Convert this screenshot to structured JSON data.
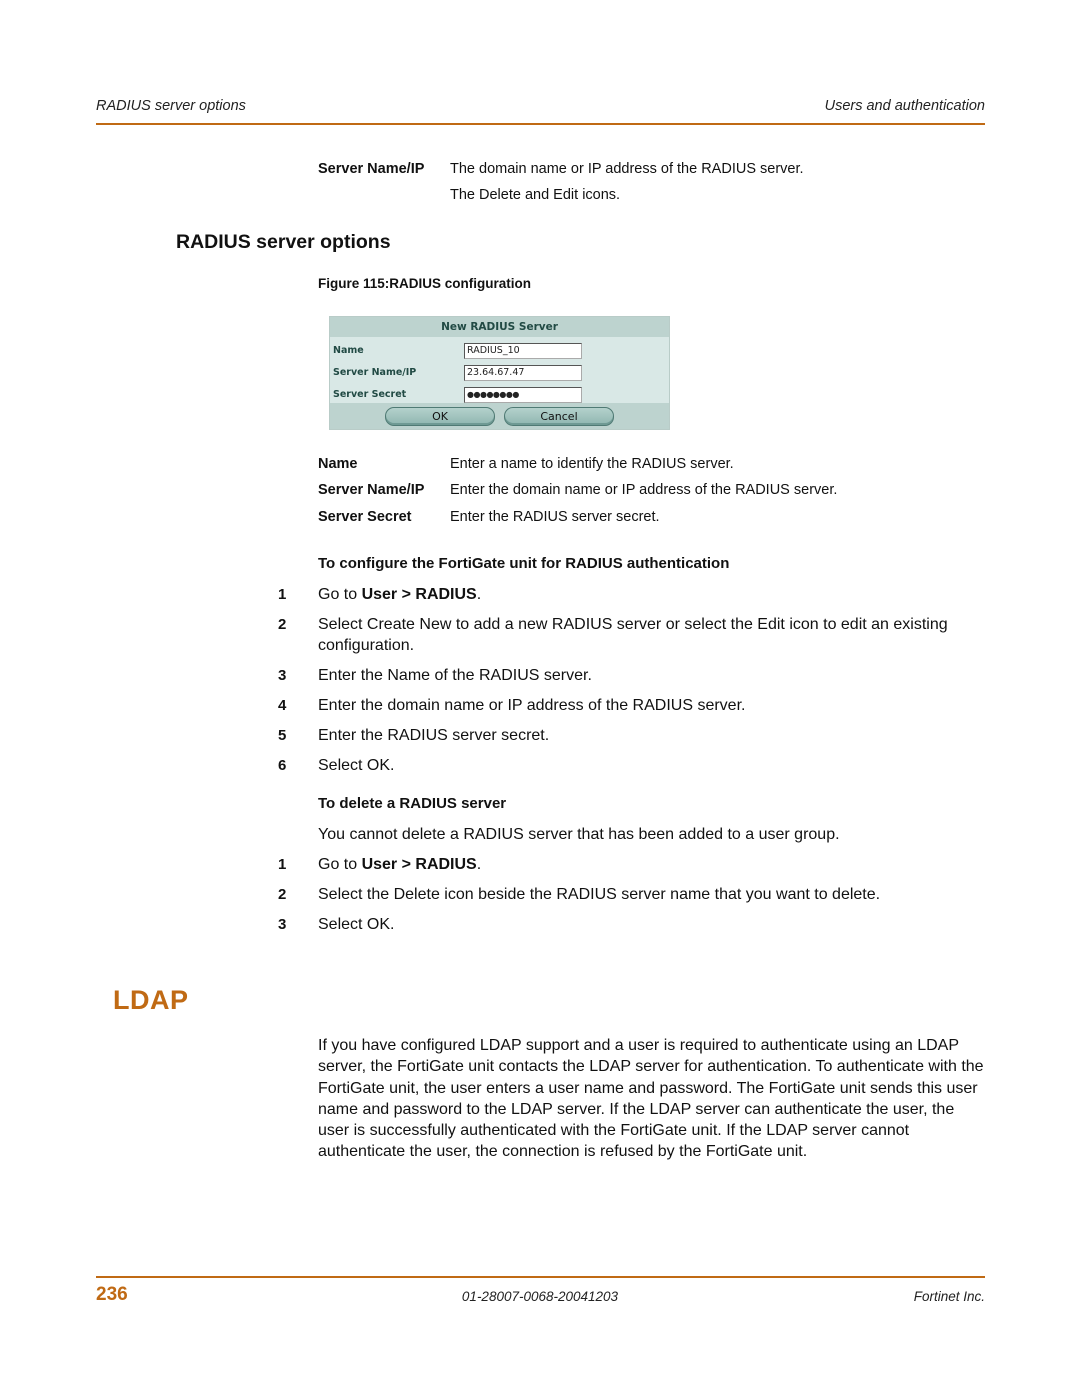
{
  "header": {
    "left": "RADIUS server options",
    "right": "Users and authentication"
  },
  "top_definitions": [
    {
      "term": "Server Name/IP",
      "desc": "The domain name or IP address of the RADIUS server."
    },
    {
      "term": "",
      "desc": "The Delete and Edit icons."
    }
  ],
  "section_title": "RADIUS server options",
  "figure_caption": "Figure 115:RADIUS configuration",
  "dialog": {
    "title": "New RADIUS Server",
    "fields": [
      {
        "label": "Name",
        "value": "RADIUS_10"
      },
      {
        "label": "Server Name/IP",
        "value": "23.64.67.47"
      },
      {
        "label": "Server Secret",
        "value": "●●●●●●●●"
      }
    ],
    "ok_label": "OK",
    "cancel_label": "Cancel"
  },
  "field_definitions": [
    {
      "term": "Name",
      "desc": "Enter a name to identify the RADIUS server."
    },
    {
      "term": "Server Name/IP",
      "desc": "Enter the domain name or IP address of the RADIUS server."
    },
    {
      "term": "Server Secret",
      "desc": "Enter the RADIUS server secret."
    }
  ],
  "configure_procedure": {
    "title": "To configure the FortiGate unit for RADIUS authentication",
    "steps": [
      {
        "num": "1",
        "pre": "Go to ",
        "bold": "User > RADIUS",
        "post": "."
      },
      {
        "num": "2",
        "pre": "Select Create New to add a new RADIUS server or select the Edit icon to edit an existing configuration.",
        "bold": "",
        "post": ""
      },
      {
        "num": "3",
        "pre": "Enter the Name of the RADIUS server.",
        "bold": "",
        "post": ""
      },
      {
        "num": "4",
        "pre": "Enter the domain name or IP address of the RADIUS server.",
        "bold": "",
        "post": ""
      },
      {
        "num": "5",
        "pre": "Enter the RADIUS server secret.",
        "bold": "",
        "post": ""
      },
      {
        "num": "6",
        "pre": "Select OK.",
        "bold": "",
        "post": ""
      }
    ]
  },
  "delete_procedure": {
    "title": "To delete a RADIUS server",
    "note": "You cannot delete a RADIUS server that has been added to a user group.",
    "steps": [
      {
        "num": "1",
        "pre": "Go to ",
        "bold": "User > RADIUS",
        "post": "."
      },
      {
        "num": "2",
        "pre": "Select the Delete icon beside the RADIUS server name that you want to delete.",
        "bold": "",
        "post": ""
      },
      {
        "num": "3",
        "pre": "Select OK.",
        "bold": "",
        "post": ""
      }
    ]
  },
  "ldap": {
    "heading": "LDAP",
    "paragraph": "If you have configured LDAP support and a user is required to authenticate using an LDAP server, the FortiGate unit contacts the LDAP server for authentication. To authenticate with the FortiGate unit, the user enters a user name and password. The FortiGate unit sends this user name and password to the LDAP server. If the LDAP server can authenticate the user, the user is successfully authenticated with the FortiGate unit. If the LDAP server cannot authenticate the user, the connection is refused by the FortiGate unit."
  },
  "footer": {
    "page_number": "236",
    "doc_id": "01-28007-0068-20041203",
    "company": "Fortinet Inc."
  },
  "colors": {
    "accent": "#c06a14",
    "dialog_bg": "#d9e8e6",
    "dialog_header": "#bdd3cf"
  }
}
